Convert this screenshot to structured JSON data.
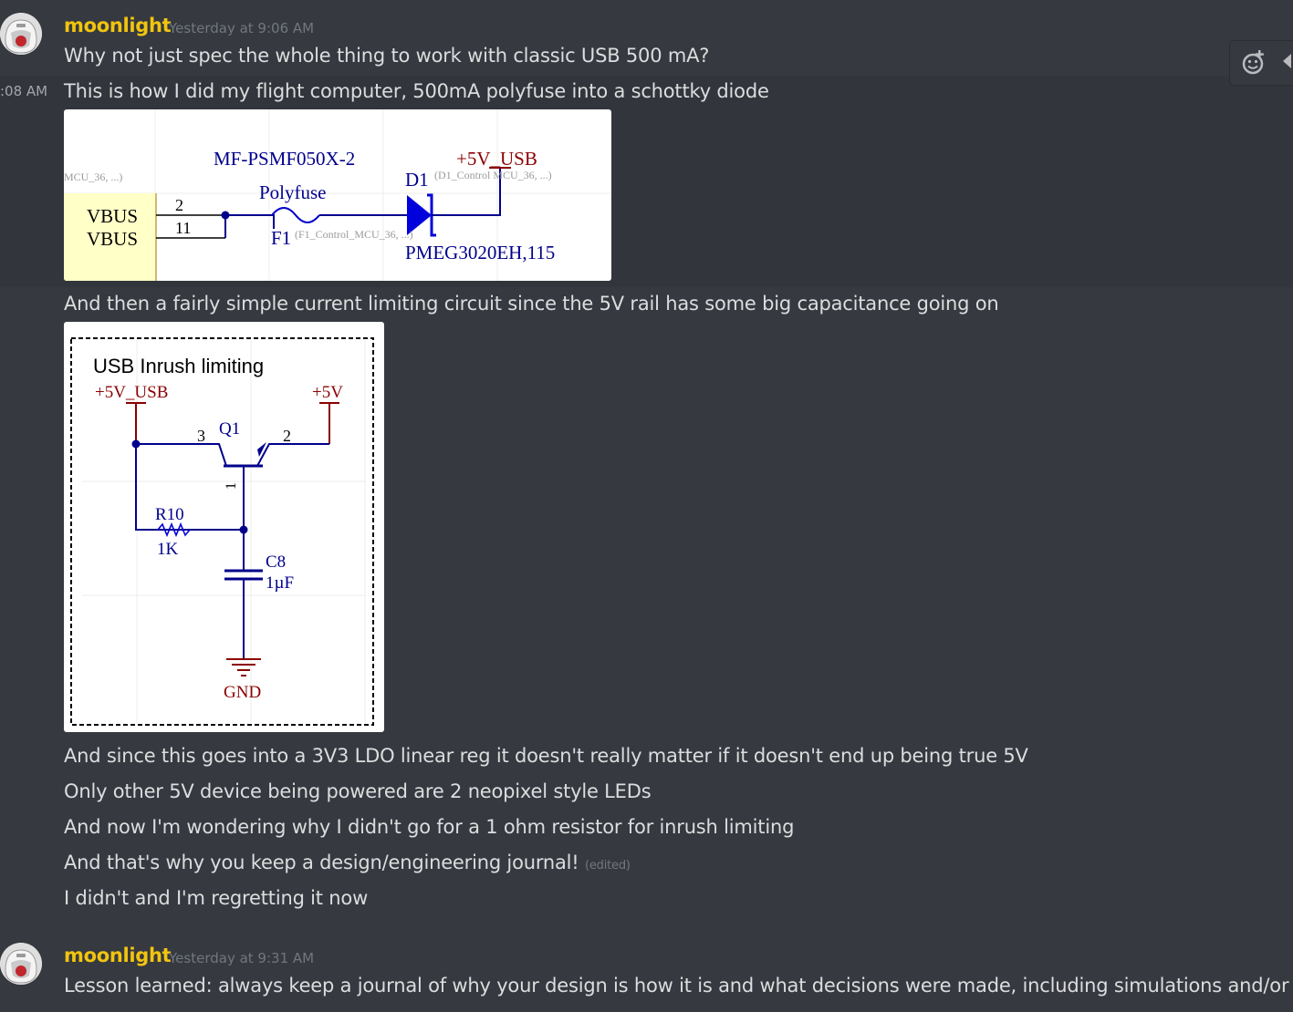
{
  "messages": [
    {
      "username": "moonlight",
      "timestamp": "Yesterday at 9:06 AM",
      "lines": [
        "Why not just spec the whole thing to work with classic USB 500 mA?"
      ]
    },
    {
      "side_time": ":08 AM",
      "line": "This is how I did my flight computer, 500mA polyfuse into a schottky diode"
    },
    {
      "line": "And then a fairly simple current limiting circuit since the 5V rail has some big capacitance going on"
    },
    {
      "lines": [
        "And since this goes into a 3V3 LDO linear reg it doesn't really matter if it doesn't end up being true 5V",
        "Only other 5V device being powered are 2 neopixel style LEDs",
        "And now I'm wondering why I didn't go for a 1 ohm resistor for inrush limiting",
        "And that's why you keep a design/engineering journal!",
        "I didn't and I'm regretting it now"
      ],
      "edited_label": "(edited)"
    },
    {
      "username": "moonlight",
      "timestamp": "Yesterday at 9:31 AM",
      "lines": [
        "Lesson learned: always keep a journal of why your design is how it is and what decisions were made, including simulations and/or"
      ]
    }
  ],
  "schematic1": {
    "left_label": "MCU_36, ...)",
    "part": "MF-PSMF050X-2",
    "net": "+5V_USB",
    "diode_ref": "D1",
    "diode_note": "(D1_Control MCU_36, ...)",
    "fuse_name": "Polyfuse",
    "fuse_ref": "F1",
    "fuse_note": "(F1_Control_MCU_36, ...)",
    "diode_part": "PMEG3020EH,115",
    "pin1": "VBUS",
    "pin2": "VBUS",
    "pin_num1": "2",
    "pin_num2": "11"
  },
  "schematic2": {
    "title": "USB Inrush limiting",
    "net_in": "+5V_USB",
    "net_out": "+5V",
    "q_ref": "Q1",
    "pin3": "3",
    "pin2": "2",
    "pin1": "1",
    "r_ref": "R10",
    "r_val": "1K",
    "c_ref": "C8",
    "c_val": "1µF",
    "gnd": "GND"
  },
  "icons": {
    "add_reaction": "add-reaction-icon",
    "avatar": "avatar-helmet-icon"
  },
  "colors": {
    "username": "#f1c40f",
    "background": "#36393f",
    "text": "#dcddde"
  }
}
